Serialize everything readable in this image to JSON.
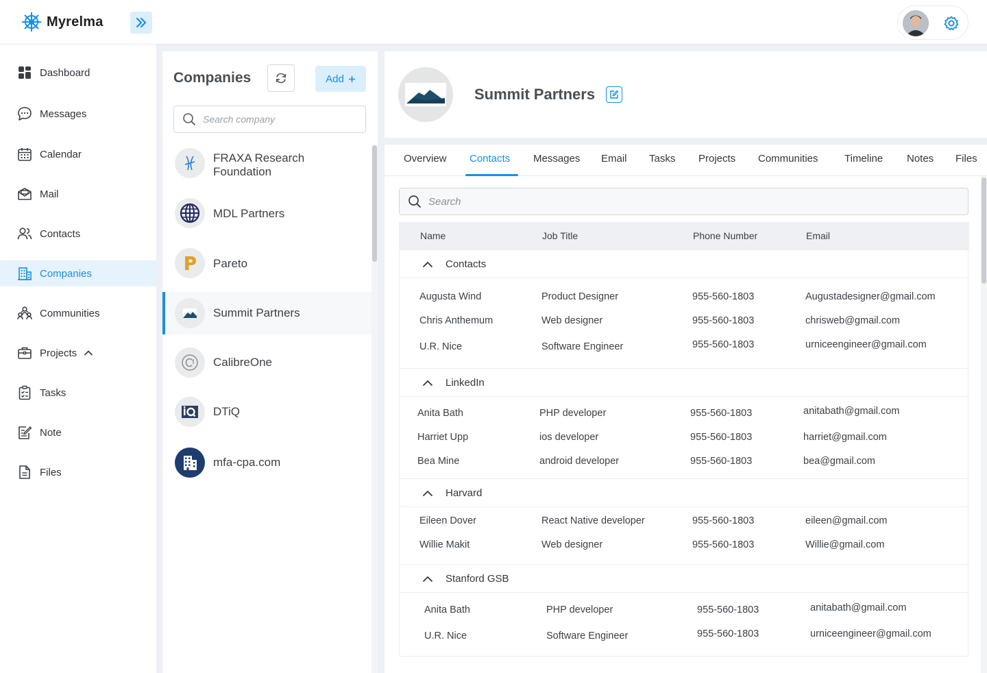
{
  "app": {
    "name": "Myrelma"
  },
  "sidebar": {
    "items": [
      {
        "label": "Dashboard",
        "icon": "dashboard-icon"
      },
      {
        "label": "Messages",
        "icon": "chat-bubble-icon"
      },
      {
        "label": "Calendar",
        "icon": "calendar-icon"
      },
      {
        "label": "Mail",
        "icon": "mail-icon"
      },
      {
        "label": "Contacts",
        "icon": "users-icon"
      },
      {
        "label": "Companies",
        "icon": "building-icon",
        "active": true
      },
      {
        "label": "Communities",
        "icon": "community-icon"
      },
      {
        "label": "Projects",
        "icon": "briefcase-icon",
        "expanded": true
      },
      {
        "label": "Tasks",
        "icon": "clipboard-icon"
      },
      {
        "label": "Note",
        "icon": "note-icon"
      },
      {
        "label": "Files",
        "icon": "file-icon"
      }
    ]
  },
  "companies": {
    "title": "Companies",
    "add_label": "Add",
    "search_placeholder": "Search company",
    "items": [
      {
        "name": "FRAXA Research Foundation"
      },
      {
        "name": "MDL Partners"
      },
      {
        "name": "Pareto"
      },
      {
        "name": "Summit Partners",
        "selected": true
      },
      {
        "name": "CalibreOne"
      },
      {
        "name": "DTiQ"
      },
      {
        "name": "mfa-cpa.com"
      }
    ]
  },
  "detail": {
    "name": "Summit Partners",
    "tabs": [
      "Overview",
      "Contacts",
      "Messages",
      "Email",
      "Tasks",
      "Projects",
      "Communities",
      "Timeline",
      "Notes",
      "Files"
    ],
    "active_tab": "Contacts",
    "search_placeholder": "Search",
    "columns": [
      "Name",
      "Job Title",
      "Phone Number",
      "Email"
    ],
    "groups": [
      {
        "name": "Contacts",
        "rows": [
          [
            "Augusta Wind",
            "Product Designer",
            "955-560-1803",
            "Augustadesigner@gmail.com"
          ],
          [
            "Chris Anthemum",
            "Web designer",
            "955-560-1803",
            "chrisweb@gmail.com"
          ],
          [
            "U.R. Nice",
            "Software Engineer",
            "955-560-1803",
            "urniceengineer@gmail.com"
          ]
        ]
      },
      {
        "name": "LinkedIn",
        "rows": [
          [
            "Anita Bath",
            "PHP developer",
            "955-560-1803",
            "anitabath@gmail.com"
          ],
          [
            "Harriet Upp",
            "ios developer",
            "955-560-1803",
            "harriet@gmail.com"
          ],
          [
            "Bea Mine",
            "android developer",
            "955-560-1803",
            "bea@gmail.com"
          ]
        ]
      },
      {
        "name": "Harvard",
        "rows": [
          [
            "Eileen Dover",
            "React Native developer",
            "955-560-1803",
            "eileen@gmail.com"
          ],
          [
            "Willie Makit",
            "Web designer",
            "955-560-1803",
            "Willie@gmail.com"
          ]
        ]
      },
      {
        "name": "Stanford GSB",
        "rows": [
          [
            "Anita Bath",
            "PHP developer",
            "955-560-1803",
            "anitabath@gmail.com"
          ],
          [
            "U.R. Nice",
            "Software Engineer",
            "955-560-1803",
            "urniceengineer@gmail.com"
          ]
        ]
      }
    ]
  },
  "colors": {
    "accent": "#1a8ee1",
    "accent_light": "#dbeefb",
    "background": "#edf0f4"
  }
}
